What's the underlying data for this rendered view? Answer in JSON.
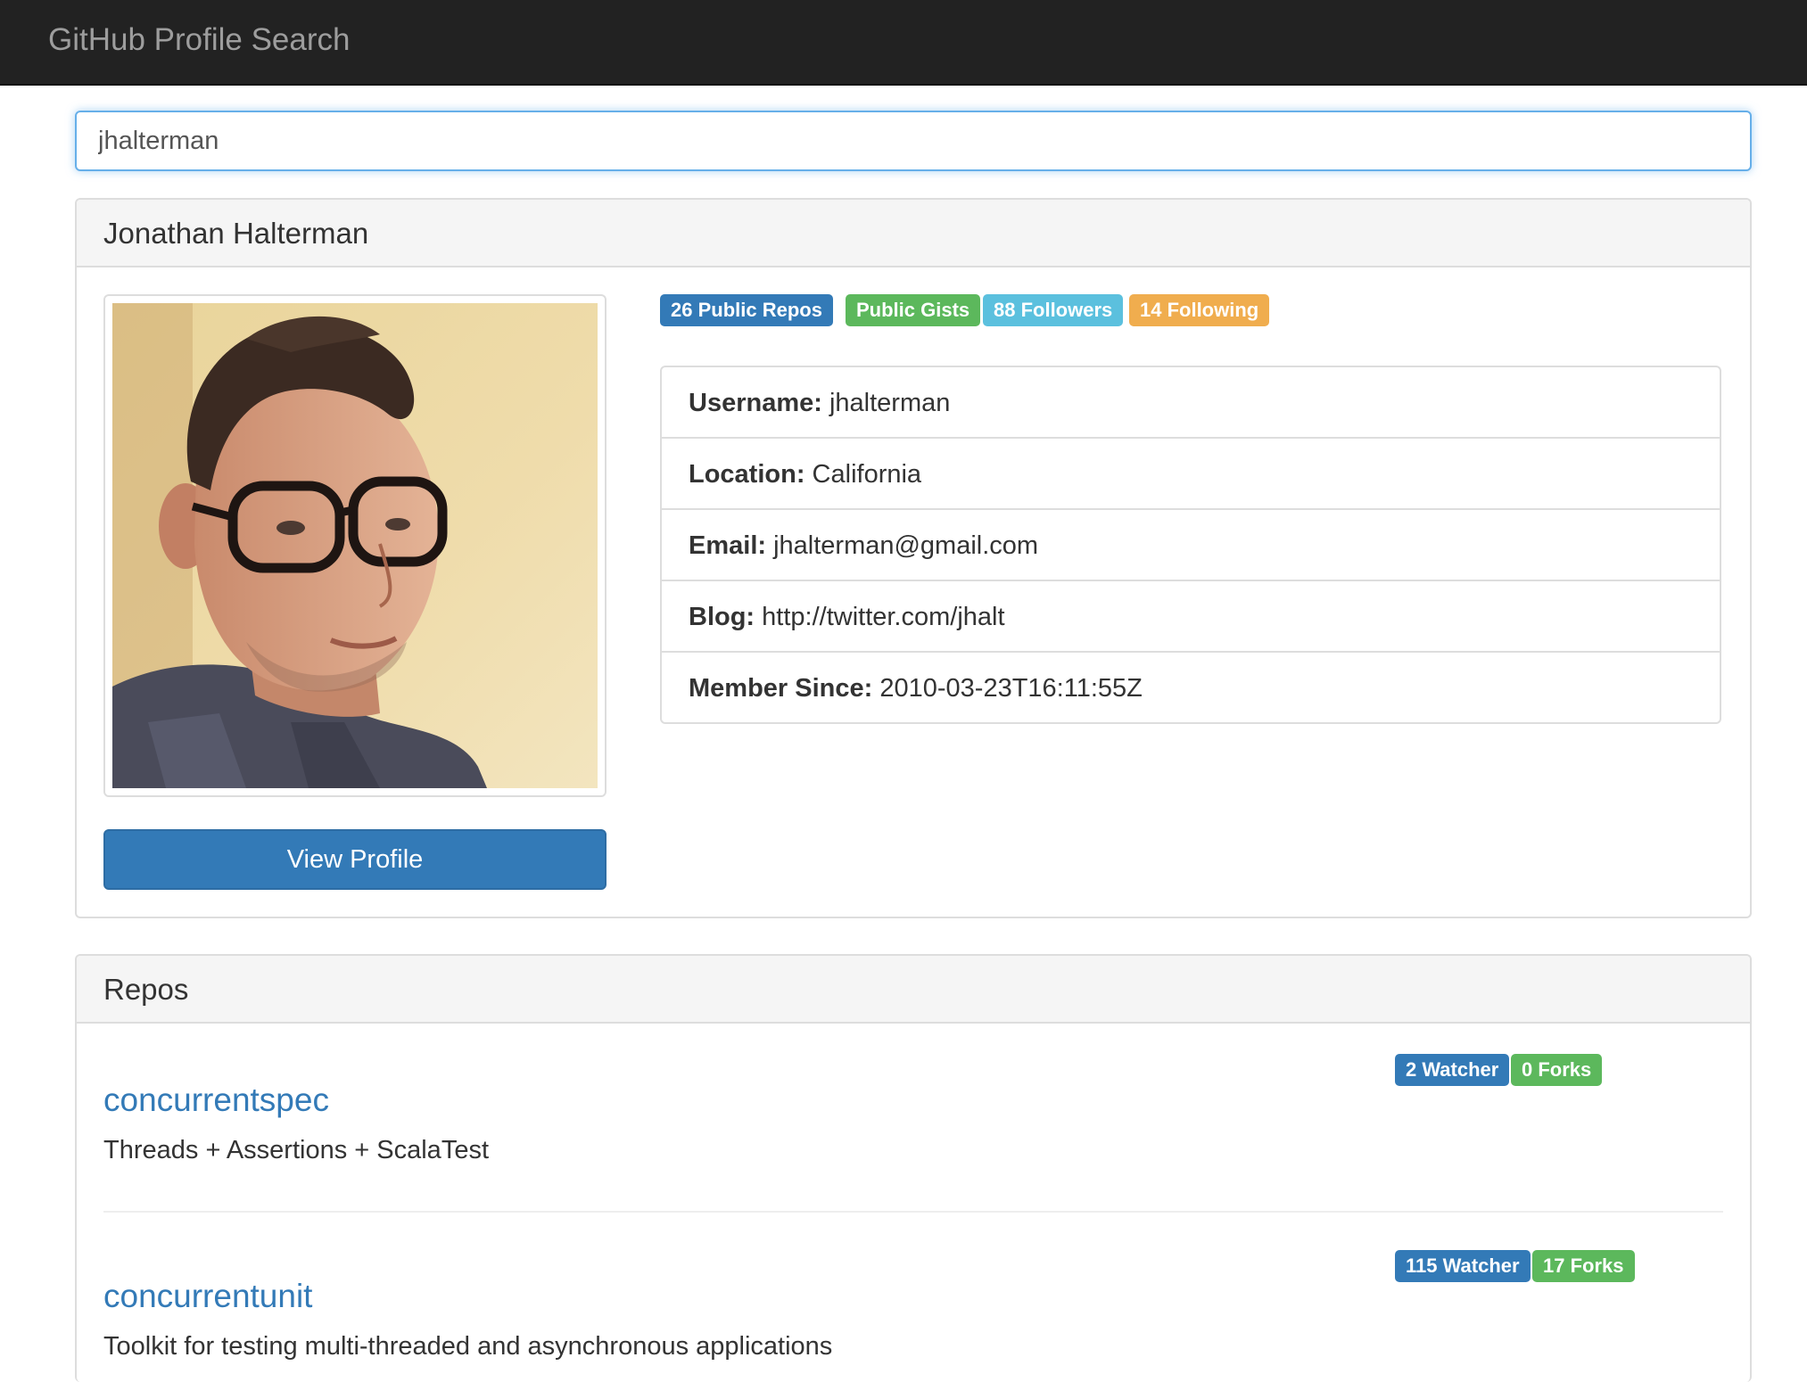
{
  "app": {
    "title": "GitHub Profile Search"
  },
  "search": {
    "value": "jhalterman",
    "placeholder": ""
  },
  "profile": {
    "name": "Jonathan Halterman",
    "badges": {
      "repos": "26 Public Repos",
      "gists": "Public Gists",
      "followers": "88 Followers",
      "following": "14 Following"
    },
    "details": [
      {
        "label": "Username:",
        "value": " jhalterman"
      },
      {
        "label": "Location:",
        "value": " California"
      },
      {
        "label": "Email:",
        "value": " jhalterman@gmail.com"
      },
      {
        "label": "Blog:",
        "value": " http://twitter.com/jhalt"
      },
      {
        "label": "Member Since:",
        "value": " 2010-03-23T16:11:55Z"
      }
    ],
    "view_profile_label": "View Profile"
  },
  "repos": {
    "title": "Repos",
    "items": [
      {
        "name": "concurrentspec",
        "description": "Threads + Assertions + ScalaTest",
        "watchers": "2 Watcher",
        "forks": "0 Forks"
      },
      {
        "name": "concurrentunit",
        "description": "Toolkit for testing multi-threaded and asynchronous applications",
        "watchers": "115 Watcher",
        "forks": "17 Forks"
      }
    ]
  },
  "colors": {
    "primary": "#337ab7",
    "success": "#5cb85c",
    "info": "#5bc0de",
    "warning": "#f0ad4e",
    "navbar": "#222222"
  }
}
